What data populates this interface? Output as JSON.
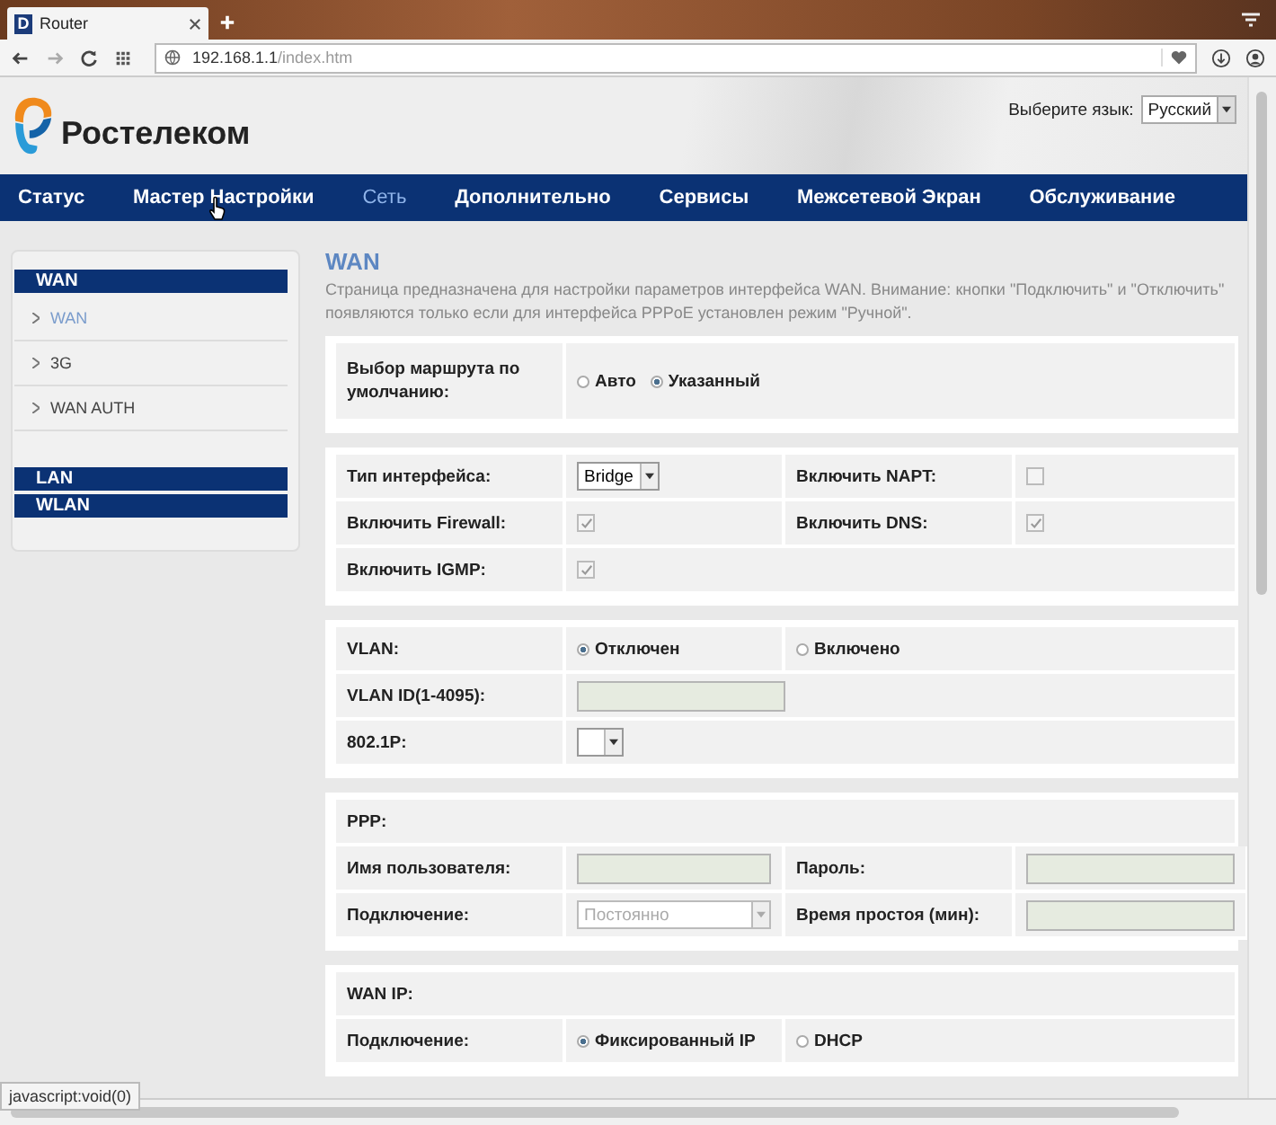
{
  "browser": {
    "favicon_letter": "D",
    "tab_title": "Router",
    "url_host": "192.168.1.1",
    "url_path": "/index.htm",
    "status_text": "javascript:void(0)"
  },
  "header": {
    "logo_text": "Ростелеком",
    "language_label": "Выберите язык:",
    "language_value": "Русский"
  },
  "nav": [
    {
      "label": "Статус",
      "selected": false
    },
    {
      "label": "Мастер Настройки",
      "selected": false
    },
    {
      "label": "Сеть",
      "selected": true
    },
    {
      "label": "Дополнительно",
      "selected": false
    },
    {
      "label": "Сервисы",
      "selected": false
    },
    {
      "label": "Межсетевой Экран",
      "selected": false
    },
    {
      "label": "Обслуживание",
      "selected": false
    }
  ],
  "sidebar": [
    {
      "title": "WAN",
      "items": [
        {
          "label": "WAN",
          "selected": true
        },
        {
          "label": "3G",
          "selected": false
        },
        {
          "label": "WAN AUTH",
          "selected": false
        }
      ]
    },
    {
      "title": "LAN"
    },
    {
      "title": "WLAN"
    }
  ],
  "content": {
    "title": "WAN",
    "description": "Страница предназначена для настройки параметров интерфейса WAN. Внимание: кнопки \"Подключить\" и \"Отключить\" появляются только если для интерфейса PPPoE установлен режим \"Ручной\".",
    "sections": [
      {
        "rows": [
          [
            {
              "kind": "label",
              "text": "Выбор маршрута по умолчанию:"
            },
            {
              "kind": "radios",
              "options": [
                {
                  "label": "Авто",
                  "selected": false
                },
                {
                  "label": "Указанный",
                  "selected": true
                }
              ]
            }
          ]
        ]
      },
      {
        "rows": [
          [
            {
              "kind": "label",
              "text": "Тип интерфейса:"
            },
            {
              "kind": "select",
              "value": "Bridge",
              "disabled": false
            },
            {
              "kind": "label",
              "text": "Включить NAPT:"
            },
            {
              "kind": "checkbox",
              "checked": false
            }
          ],
          [
            {
              "kind": "label",
              "text": "Включить Firewall:"
            },
            {
              "kind": "checkbox",
              "checked": true
            },
            {
              "kind": "label",
              "text": "Включить DNS:"
            },
            {
              "kind": "checkbox",
              "checked": true
            }
          ],
          [
            {
              "kind": "label",
              "text": "Включить IGMP:"
            },
            {
              "kind": "checkbox",
              "checked": true
            }
          ]
        ]
      },
      {
        "rows": [
          [
            {
              "kind": "label",
              "text": "VLAN:"
            },
            {
              "kind": "radio",
              "label": "Отключен",
              "selected": true
            },
            {
              "kind": "radio",
              "label": "Включено",
              "selected": false
            }
          ],
          [
            {
              "kind": "label",
              "text": "VLAN ID(1-4095):"
            },
            {
              "kind": "input"
            }
          ],
          [
            {
              "kind": "label",
              "text": "802.1P:"
            },
            {
              "kind": "select",
              "disabled": false
            }
          ]
        ]
      },
      {
        "rows": [
          [
            {
              "kind": "label",
              "text": "PPP:"
            }
          ],
          [
            {
              "kind": "label",
              "text": "Имя пользователя:"
            },
            {
              "kind": "input"
            },
            {
              "kind": "label",
              "text": "Пароль:"
            },
            {
              "kind": "input"
            }
          ],
          [
            {
              "kind": "label",
              "text": "Подключение:"
            },
            {
              "kind": "select",
              "value": "Постоянно",
              "disabled": true
            },
            {
              "kind": "label",
              "text": "Время простоя (мин):"
            },
            {
              "kind": "input"
            }
          ]
        ]
      },
      {
        "rows": [
          [
            {
              "kind": "label",
              "text": "WAN IP:"
            }
          ],
          [
            {
              "kind": "label",
              "text": "Подключение:"
            },
            {
              "kind": "radio",
              "label": "Фиксированный IP",
              "selected": true
            },
            {
              "kind": "radio",
              "label": "DHCP",
              "selected": false
            }
          ]
        ]
      }
    ]
  }
}
